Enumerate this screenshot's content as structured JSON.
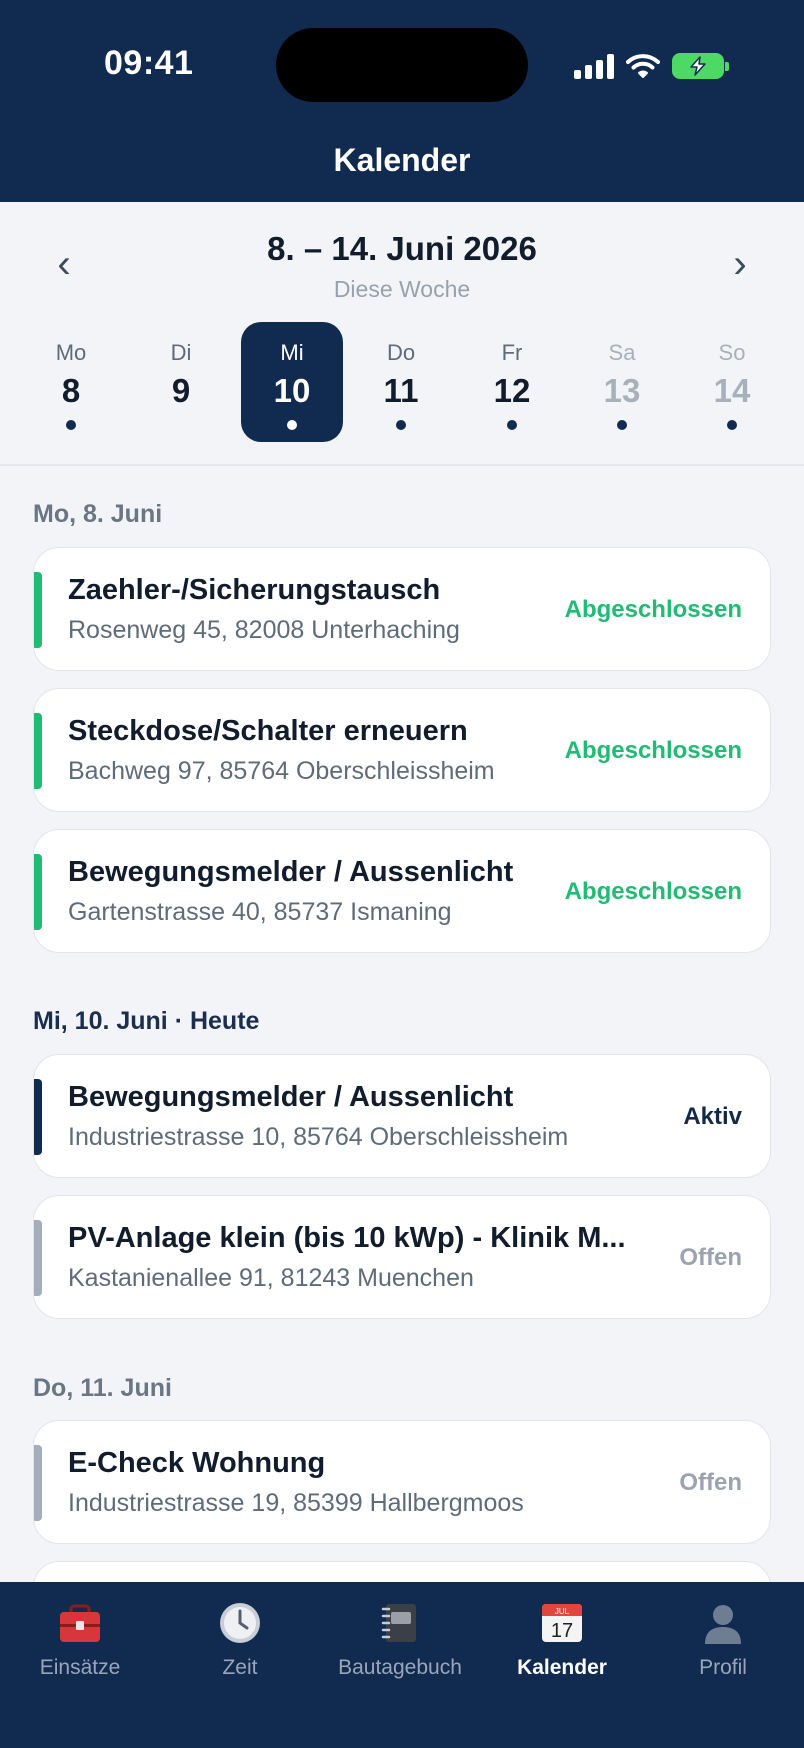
{
  "status_bar": {
    "time": "09:41"
  },
  "header": {
    "title": "Kalender"
  },
  "week": {
    "range": "8. – 14. Juni 2026",
    "subtitle": "Diese Woche",
    "prev_label": "‹",
    "next_label": "›",
    "days": [
      {
        "name": "Mo",
        "date": "8"
      },
      {
        "name": "Di",
        "date": "9"
      },
      {
        "name": "Mi",
        "date": "10"
      },
      {
        "name": "Do",
        "date": "11"
      },
      {
        "name": "Fr",
        "date": "12"
      },
      {
        "name": "Sa",
        "date": "13"
      },
      {
        "name": "So",
        "date": "14"
      }
    ]
  },
  "sections": [
    {
      "heading": "Mo, 8. Juni",
      "items": [
        {
          "title": "Zaehler-/Sicherungstausch",
          "address": "Rosenweg 45, 82008 Unterhaching",
          "status": "Abgeschlossen"
        },
        {
          "title": "Steckdose/Schalter erneuern",
          "address": "Bachweg 97, 85764 Oberschleissheim",
          "status": "Abgeschlossen"
        },
        {
          "title": "Bewegungsmelder / Aussenlicht",
          "address": "Gartenstrasse 40, 85737 Ismaning",
          "status": "Abgeschlossen"
        }
      ]
    },
    {
      "heading": "Mi, 10. Juni · Heute",
      "items": [
        {
          "title": "Bewegungsmelder / Aussenlicht",
          "address": "Industriestrasse 10, 85764 Oberschleissheim",
          "status": "Aktiv"
        },
        {
          "title": "PV-Anlage klein (bis 10 kWp) - Klinik M...",
          "address": "Kastanienallee 91, 81243 Muenchen",
          "status": "Offen"
        }
      ]
    },
    {
      "heading": "Do, 11. Juni",
      "items": [
        {
          "title": "E-Check Wohnung",
          "address": "Industriestrasse 19, 85399 Hallbergmoos",
          "status": "Offen"
        }
      ]
    }
  ],
  "tabs": [
    {
      "label": "Einsätze",
      "icon": "toolbox-icon"
    },
    {
      "label": "Zeit",
      "icon": "clock-icon"
    },
    {
      "label": "Bautagebuch",
      "icon": "notebook-icon"
    },
    {
      "label": "Kalender",
      "icon": "calendar-icon",
      "calendar_month": "JUL",
      "calendar_day": "17"
    },
    {
      "label": "Profil",
      "icon": "profile-icon"
    }
  ],
  "colors": {
    "navy": "#112b50",
    "done": "#22bb73",
    "open": "#9aa3af",
    "battery": "#4cd964"
  }
}
